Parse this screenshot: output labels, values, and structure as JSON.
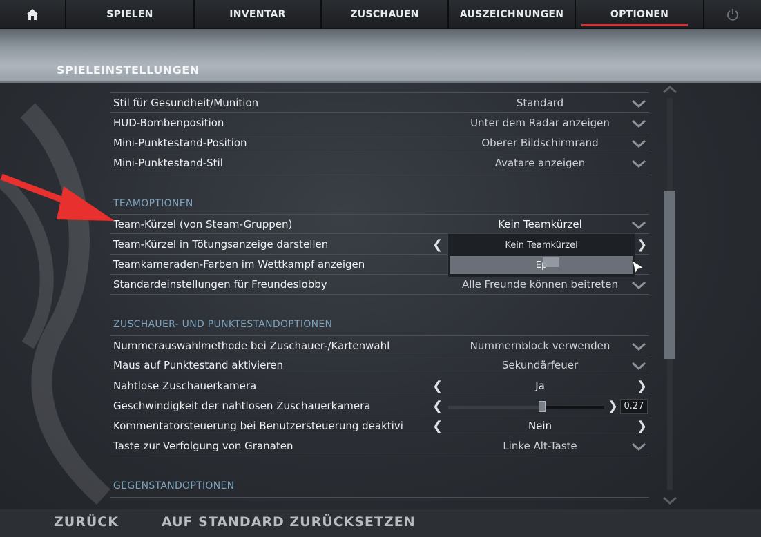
{
  "nav": {
    "home_icon": "home-icon",
    "items": [
      "SPIELEN",
      "INVENTAR",
      "ZUSCHAUEN",
      "AUSZEICHNUNGEN",
      "OPTIONEN"
    ],
    "active": "OPTIONEN",
    "power_icon": "power-icon"
  },
  "page": {
    "title": "SPIELEINSTELLUNGEN"
  },
  "hud": {
    "rows": [
      {
        "label": "Stil für Gesundheit/Munition",
        "value": "Standard"
      },
      {
        "label": "HUD-Bombenposition",
        "value": "Unter dem Radar anzeigen"
      },
      {
        "label": "Mini-Punktestand-Position",
        "value": "Oberer Bildschirmrand"
      },
      {
        "label": "Mini-Punktestand-Stil",
        "value": "Avatare anzeigen"
      }
    ]
  },
  "team": {
    "heading": "TEAMOPTIONEN",
    "rows": [
      {
        "label": "Team-Kürzel (von Steam-Gruppen)",
        "value": "Kein Teamkürzel"
      },
      {
        "label": "Team-Kürzel in Tötungsanzeige darstellen",
        "value": ""
      },
      {
        "label": "Teamkameraden-Farben im Wettkampf anzeigen",
        "value": ""
      },
      {
        "label": "Standardeinstellungen für Freundeslobby",
        "value": "Alle Freunde können beitreten"
      }
    ],
    "dropdown": {
      "options": [
        "Kein Teamkürzel",
        "Ep"
      ],
      "highlighted": "Ep"
    }
  },
  "spectator": {
    "heading": "ZUSCHAUER- UND PUNKTESTANDOPTIONEN",
    "rows": [
      {
        "label": "Nummerauswahlmethode bei Zuschauer-/Kartenwahl",
        "value": "Nummernblock verwenden"
      },
      {
        "label": "Maus auf Punktestand aktivieren",
        "value": "Sekundärfeuer"
      },
      {
        "label": "Nahtlose Zuschauerkamera",
        "value": "Ja"
      },
      {
        "label": "Geschwindigkeit der nahtlosen Zuschauerkamera",
        "value": ""
      },
      {
        "label": "Kommentatorsteuerung bei Benutzersteuerung deaktivi",
        "value": "Nein"
      },
      {
        "label": "Taste zur Verfolgung von Granaten",
        "value": "Linke Alt-Taste"
      }
    ],
    "slider": {
      "value": "0.27",
      "fraction": 0.6
    }
  },
  "items_section": {
    "heading": "GEGENSTANDOPTIONEN"
  },
  "bottom": {
    "back": "ZURÜCK",
    "reset": "AUF STANDARD ZURÜCKSETZEN"
  },
  "colors": {
    "accent": "#d0343a",
    "section": "#7fa3bd",
    "annotation": "#e8312e"
  }
}
